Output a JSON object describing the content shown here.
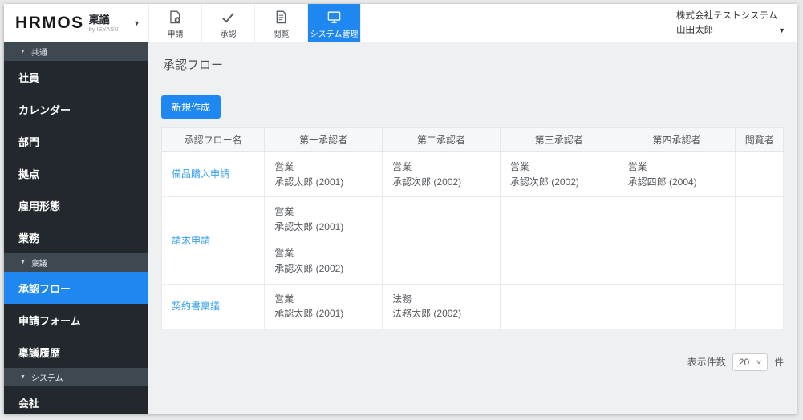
{
  "colors": {
    "accent_blue": "#1e88f0",
    "sidebar_bg": "#22282d",
    "section_header_bg": "#3e4851",
    "link_blue": "#38a0e8",
    "main_bg": "#eef0f1"
  },
  "topbar": {
    "logo": {
      "brand": "HRMOS",
      "product": "稟議",
      "byline": "by IEYASU",
      "caret": "▼"
    },
    "nav": [
      {
        "label": "申請",
        "icon": "doc-plus-icon",
        "active": false
      },
      {
        "label": "承認",
        "icon": "check-icon",
        "active": false
      },
      {
        "label": "閲覧",
        "icon": "doc-icon",
        "active": false
      },
      {
        "label": "システム管理",
        "icon": "monitor-icon",
        "active": true
      }
    ],
    "company": "株式会社テストシステム",
    "user": "山田太郎",
    "user_caret": "▼"
  },
  "sidebar": {
    "sections": [
      {
        "label": "共通",
        "triangle": "▼",
        "items": [
          {
            "label": "社員",
            "active": false
          },
          {
            "label": "カレンダー",
            "active": false
          },
          {
            "label": "部門",
            "active": false
          },
          {
            "label": "拠点",
            "active": false
          },
          {
            "label": "雇用形態",
            "active": false
          },
          {
            "label": "業務",
            "active": false
          }
        ]
      },
      {
        "label": "稟議",
        "triangle": "▼",
        "items": [
          {
            "label": "承認フロー",
            "active": true
          },
          {
            "label": "申請フォーム",
            "active": false
          },
          {
            "label": "稟議履歴",
            "active": false
          }
        ]
      },
      {
        "label": "システム",
        "triangle": "▼",
        "items": [
          {
            "label": "会社",
            "active": false
          }
        ]
      }
    ]
  },
  "main": {
    "title": "承認フロー",
    "create_button": "新規作成",
    "table": {
      "headers": [
        "承認フロー名",
        "第一承認者",
        "第二承認者",
        "第三承認者",
        "第四承認者",
        "閲覧者"
      ],
      "rows": [
        {
          "name": "備品購入申請",
          "tall": false,
          "cells": [
            [
              {
                "dept": "営業",
                "person": "承認太郎 (2001)"
              }
            ],
            [
              {
                "dept": "営業",
                "person": "承認次郎 (2002)"
              }
            ],
            [
              {
                "dept": "営業",
                "person": "承認次郎 (2002)"
              }
            ],
            [
              {
                "dept": "営業",
                "person": "承認四郎 (2004)"
              }
            ],
            []
          ]
        },
        {
          "name": "請求申請",
          "tall": true,
          "cells": [
            [
              {
                "dept": "営業",
                "person": "承認太郎 (2001)"
              },
              {
                "dept": "営業",
                "person": "承認次郎 (2002)"
              }
            ],
            [],
            [],
            [],
            []
          ]
        },
        {
          "name": "契約書稟議",
          "tall": false,
          "cells": [
            [
              {
                "dept": "営業",
                "person": "承認太郎 (2001)"
              }
            ],
            [
              {
                "dept": "法務",
                "person": "法務太郎 (2002)"
              }
            ],
            [],
            [],
            []
          ]
        }
      ]
    },
    "pagination": {
      "label": "表示件数",
      "value": "20",
      "suffix": "件",
      "chevron": "∨"
    }
  }
}
